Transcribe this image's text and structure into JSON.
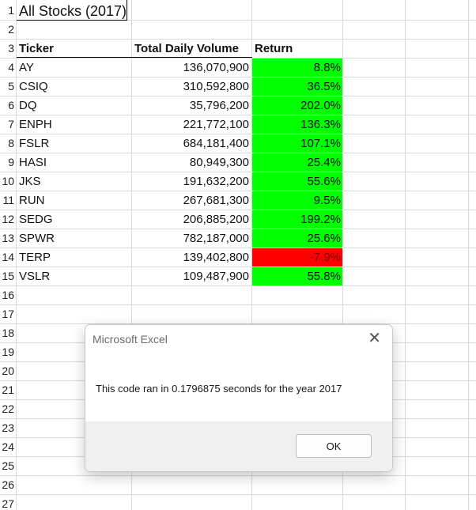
{
  "sheet": {
    "title": "All Stocks (2017)",
    "headers": {
      "ticker": "Ticker",
      "volume": "Total Daily Volume",
      "return": "Return"
    },
    "rows": [
      {
        "ticker": "AY",
        "volume": "136,070,900",
        "return": "8.8%",
        "status": "positive"
      },
      {
        "ticker": "CSIQ",
        "volume": "310,592,800",
        "return": "36.5%",
        "status": "positive"
      },
      {
        "ticker": "DQ",
        "volume": "35,796,200",
        "return": "202.0%",
        "status": "positive"
      },
      {
        "ticker": "ENPH",
        "volume": "221,772,100",
        "return": "136.3%",
        "status": "positive"
      },
      {
        "ticker": "FSLR",
        "volume": "684,181,400",
        "return": "107.1%",
        "status": "positive"
      },
      {
        "ticker": "HASI",
        "volume": "80,949,300",
        "return": "25.4%",
        "status": "positive"
      },
      {
        "ticker": "JKS",
        "volume": "191,632,200",
        "return": "55.6%",
        "status": "positive"
      },
      {
        "ticker": "RUN",
        "volume": "267,681,300",
        "return": "9.5%",
        "status": "positive"
      },
      {
        "ticker": "SEDG",
        "volume": "206,885,200",
        "return": "199.2%",
        "status": "positive"
      },
      {
        "ticker": "SPWR",
        "volume": "782,187,000",
        "return": "25.6%",
        "status": "positive"
      },
      {
        "ticker": "TERP",
        "volume": "139,402,800",
        "return": "-7.9%",
        "status": "negative"
      },
      {
        "ticker": "VSLR",
        "volume": "109,487,900",
        "return": "55.8%",
        "status": "positive"
      }
    ],
    "row_numbers": [
      "1",
      "2",
      "3",
      "4",
      "5",
      "6",
      "7",
      "8",
      "9",
      "10",
      "11",
      "12",
      "13",
      "14",
      "15",
      "16",
      "17",
      "18",
      "19",
      "20",
      "21",
      "22",
      "23",
      "24",
      "25",
      "26",
      "27"
    ],
    "colors": {
      "positive": "#00ff00",
      "negative": "#ff0000"
    }
  },
  "dialog": {
    "title": "Microsoft Excel",
    "message": "This code ran in 0.1796875 seconds for the year 2017",
    "ok_label": "OK",
    "close_icon": "close-icon"
  }
}
